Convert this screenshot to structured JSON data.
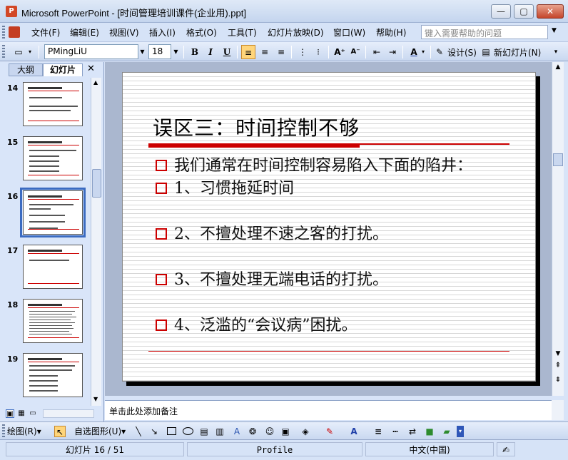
{
  "window": {
    "title": "Microsoft PowerPoint - [时间管理培训课件(企业用).ppt]",
    "app_icon_label": "P",
    "minimize": "—",
    "maximize": "▢",
    "close": "✕"
  },
  "menu": {
    "items": [
      "文件(F)",
      "编辑(E)",
      "视图(V)",
      "插入(I)",
      "格式(O)",
      "工具(T)",
      "幻灯片放映(D)",
      "窗口(W)",
      "帮助(H)"
    ],
    "help_placeholder": "键入需要帮助的问题",
    "help_arrow": "▼"
  },
  "toolbar": {
    "font_name": "PMingLiU",
    "font_size": "18",
    "bold": "B",
    "italic": "I",
    "underline": "U",
    "design_label": "设计(S)",
    "new_slide_label": "新幻灯片(N)"
  },
  "left_pane": {
    "tab_outline": "大纲",
    "tab_slides": "幻灯片",
    "close": "✕",
    "thumbnails": [
      {
        "number": "14",
        "selected": false
      },
      {
        "number": "15",
        "selected": false
      },
      {
        "number": "16",
        "selected": true
      },
      {
        "number": "17",
        "selected": false
      },
      {
        "number": "18",
        "selected": false
      },
      {
        "number": "19",
        "selected": false
      }
    ]
  },
  "slide": {
    "title": "误区三：时间控制不够",
    "bullets": [
      "我们通常在时间控制容易陷入下面的陷井：",
      "1、习惯拖延时间",
      "2、不擅处理不速之客的打扰。",
      "3、不擅处理无端电话的打扰。",
      "4、泛滥的“会议病”困扰。"
    ]
  },
  "notes": {
    "placeholder": "单击此处添加备注"
  },
  "drawing_toolbar": {
    "draw_label": "绘图(R)▾",
    "autoshapes_label": "自选图形(U)▾"
  },
  "statusbar": {
    "slide_position": "幻灯片 16 / 51",
    "design_name": "Profile",
    "language": "中文(中国)"
  },
  "colors": {
    "accent_red": "#c00000",
    "selection_blue": "#3b6bc1"
  }
}
